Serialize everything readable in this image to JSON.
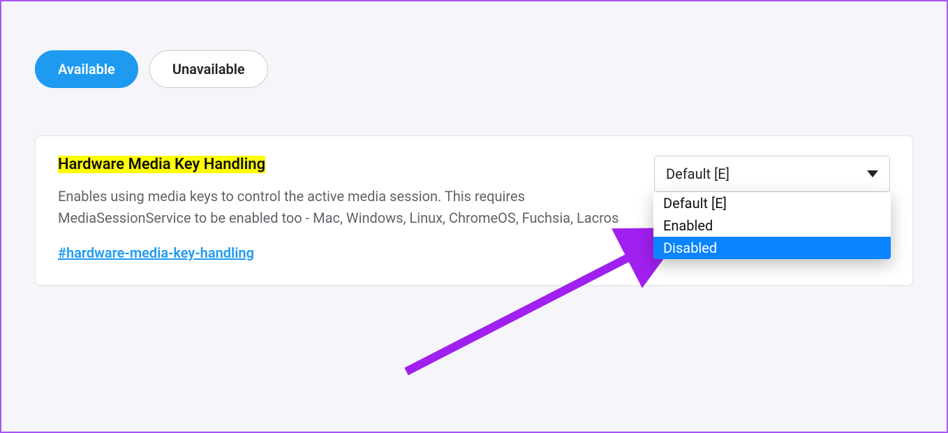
{
  "tabs": {
    "available": "Available",
    "unavailable": "Unavailable"
  },
  "flag": {
    "title": "Hardware Media Key Handling",
    "description": "Enables using media keys to control the active media session. This requires MediaSessionService to be enabled too - Mac, Windows, Linux, ChromeOS, Fuchsia, Lacros",
    "anchor": "#hardware-media-key-handling"
  },
  "select": {
    "value": "Default [E]",
    "options": {
      "default": "Default [E]",
      "enabled": "Enabled",
      "disabled": "Disabled"
    }
  },
  "annotation": {
    "arrowColor": "#a020f0"
  }
}
